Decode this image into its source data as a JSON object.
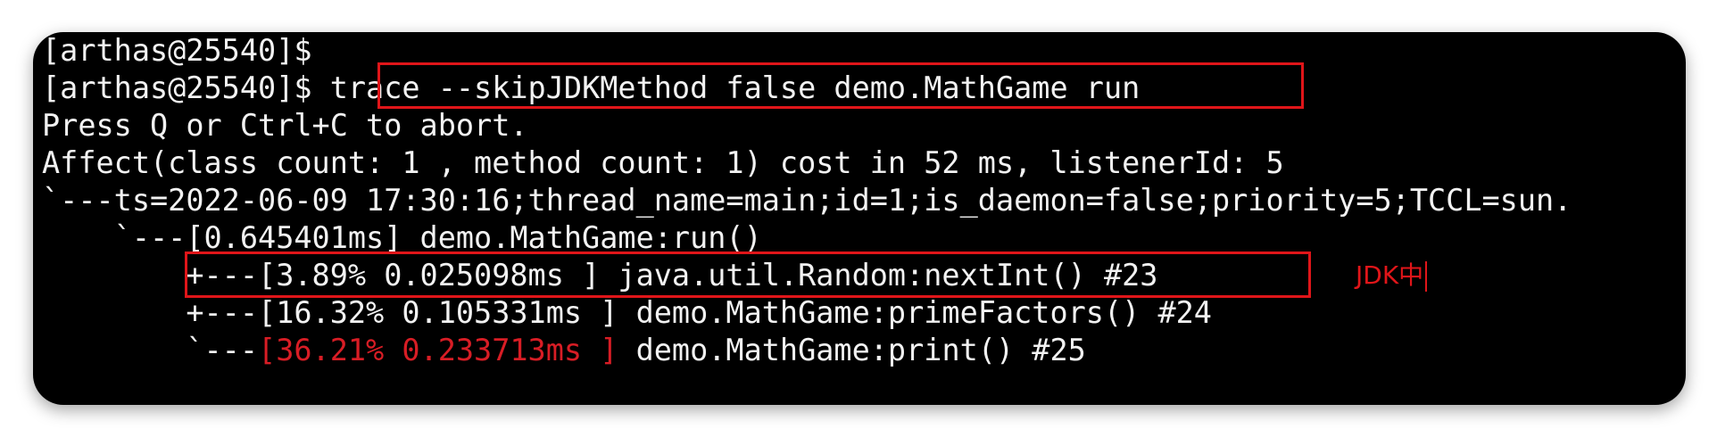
{
  "terminal": {
    "lines": [
      "[arthas@25540]$",
      "[arthas@25540]$ ",
      "Press Q or Ctrl+C to abort.",
      "Affect(class count: 1 , method count: 1) cost in 52 ms, listenerId: 5",
      "`---ts=2022-06-09 17:30:16;thread_name=main;id=1;is_daemon=false;priority=5;TCCL=sun.",
      "    `---[0.645401ms] demo.MathGame:run()",
      "        +---[3.89% 0.025098ms ] java.util.Random:nextInt() #23",
      "        +---[16.32% 0.105331ms ] demo.MathGame:primeFactors() #24",
      "        `---"
    ],
    "command": "trace --skipJDKMethod false demo.MathGame run",
    "last_line_highlight": "[36.21% 0.233713ms ]",
    "last_line_rest": " demo.MathGame:print() #25",
    "highlight_color": "#d81d25",
    "background_color": "#000000",
    "text_color": "#f2f2f2"
  },
  "annotation": {
    "text": "JDK中",
    "color": "#e01519"
  }
}
